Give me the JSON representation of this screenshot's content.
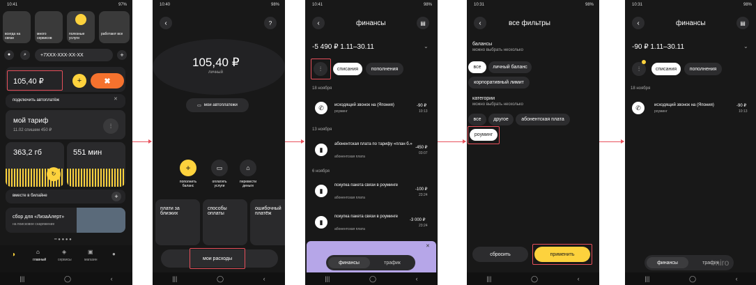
{
  "p1": {
    "status_time": "10:41",
    "battery": "97%",
    "stories": [
      "всегда на связи",
      "много сервисов",
      "полезные услуги",
      "работают все"
    ],
    "phone": "+7XXX-XXX-XX-XX",
    "balance": "105,40 ₽",
    "autopay": "подключить автоплатёж",
    "tariff_title": "мой тариф",
    "tariff_sub": "11.02 спишем 450 ₽",
    "gb": "363,2 гб",
    "min": "551 мин",
    "together": "вместе в билайне",
    "promo_title": "сбор для «ЛизаАлерт»",
    "promo_sub": "на поисковое снаряжение",
    "tabs": [
      "главный",
      "сервисы",
      "магазин",
      ""
    ]
  },
  "p2": {
    "status_time": "10:40",
    "battery": "98%",
    "balance": "105,40 ₽",
    "balance_sub": "личный",
    "autopay": "мои автоплатежи",
    "actions": [
      "пополнить баланс",
      "оплатить услуги",
      "перевести деньги"
    ],
    "cards": [
      "плати за близких",
      "способы оплаты",
      "ошибочный платёж"
    ],
    "my_spend": "мои расходы"
  },
  "p3": {
    "status_time": "10:41",
    "battery": "98%",
    "title": "финансы",
    "total": "-5 490 ₽ 1.11–30.11",
    "chips": [
      "списания",
      "пополнения"
    ],
    "groups": [
      {
        "date": "18 ноября",
        "items": [
          {
            "name": "исходящий звонок на  (Япония)",
            "sub": "роуминг",
            "amount": "-90 ₽",
            "time": "10:13"
          }
        ]
      },
      {
        "date": "13 ноября",
        "items": [
          {
            "name": "абонентская плата по тарифу «план б.»",
            "sub": "абонентская плата",
            "amount": "-450 ₽",
            "time": "03:07"
          }
        ]
      },
      {
        "date": "6 ноября",
        "items": [
          {
            "name": "покупка пакета связи в роуминге",
            "sub": "абонентская плата",
            "amount": "-100 ₽",
            "time": "23:24"
          },
          {
            "name": "покупка пакета связи в роуминге",
            "sub": "абонентская плата",
            "amount": "-3 000 ₽",
            "time": "23:24"
          }
        ]
      }
    ],
    "bottom_tabs": [
      "финансы",
      "трафик"
    ]
  },
  "p4": {
    "status_time": "10:31",
    "battery": "98%",
    "title": "все фильтры",
    "balances_h": "балансы",
    "balances_sub": "можно выбрать несколько",
    "balance_chips": [
      "все",
      "личный баланс",
      "корпоративный лимит"
    ],
    "cats_h": "категории",
    "cats_sub": "можно выбрать несколько",
    "cat_chips": [
      "все",
      "другое",
      "абонентская плата",
      "роуминг"
    ],
    "reset": "сбросить",
    "apply": "применить"
  },
  "p5": {
    "status_time": "10:31",
    "battery": "98%",
    "title": "финансы",
    "total": "-90 ₽ 1.11–30.11",
    "chips": [
      "списания",
      "пополнения"
    ],
    "date": "18 ноября",
    "item": {
      "name": "исходящий звонок на  (Япония)",
      "sub": "роуминг",
      "amount": "-90 ₽",
      "time": "10:13"
    },
    "bottom_tabs": [
      "финансы",
      "трафик"
    ],
    "watermark": "miro"
  }
}
